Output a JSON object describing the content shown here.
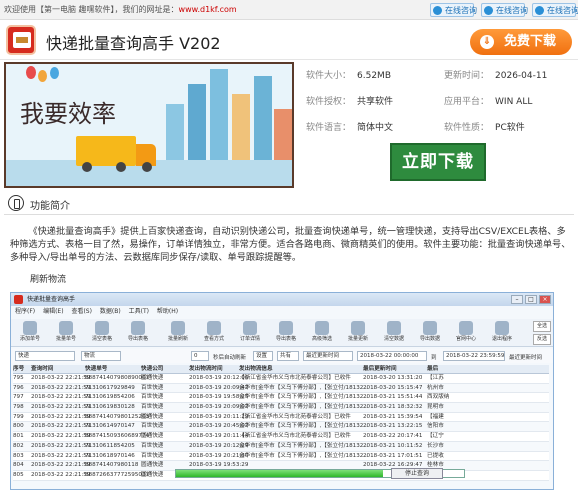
{
  "topbar": {
    "welcome": "欢迎使用【第一电脑 趣嘿软件】，我们的网址是：",
    "url": "www.d1kf.com",
    "consult_buttons": [
      "在线咨询",
      "在线咨询",
      "在线咨询"
    ]
  },
  "header": {
    "title": "快递批量查询高手 V202",
    "download_label": "免费下载"
  },
  "banner": {
    "slogan": "我要效率"
  },
  "info": {
    "size_label": "软件大小：",
    "size": "6.52MB",
    "updated_label": "更新时间：",
    "updated": "2026-04-11",
    "license_label": "软件授权：",
    "license": "共享软件",
    "platform_label": "应用平台：",
    "platform": "WIN ALL",
    "language_label": "软件语言：",
    "language": "简体中文",
    "nature_label": "软件性质：",
    "nature": "PC软件",
    "download_now": "立即下载"
  },
  "section": {
    "title": "功能简介",
    "description": "《快递批量查询高手》提供上百家快递查询，自动识别快递公司，批量查询快递单号，统一管理快递，支持导出CSV/EXCEL表格、多种筛选方式、表格一目了然，易操作，订单详情独立，非常方便。适合各路电商、微商精英们的使用。软件主要功能：批量查询快递单号、多种导入/导出单号的方法、云数据库同步保存/读取、单号跟踪提醒等。",
    "subheading": "刷新物流"
  },
  "app": {
    "window_title": "快递批量查询高手",
    "menu": [
      "程序(F)",
      "编辑(E)",
      "查看(S)",
      "数据(B)",
      "工具(T)",
      "帮助(H)"
    ],
    "toolbar": [
      "添加单号",
      "批量单号",
      "清空表格",
      "导出表格",
      "批量刷新",
      "查看方式",
      "订单详情",
      "导出表格",
      "高级筛选",
      "批量更新",
      "清空数据",
      "导出数据",
      "官网中心",
      "退出程序"
    ],
    "side_buttons": [
      "全选",
      "反选"
    ],
    "filter": {
      "type": "快递",
      "status": "物流",
      "count": "0",
      "auto_refresh": "秒后自动刷新",
      "setting": "设置",
      "all": "共有",
      "recent": "最近更新时间",
      "range_from": "2018-03-22 00:00:00",
      "to": "到",
      "range_to": "2018-03-22 23:59:59",
      "recent_label": "最近更新时间"
    },
    "columns": [
      "序号",
      "查询时间",
      "快递单号",
      "快递公司",
      "发出物流时间",
      "发出物流信息",
      "最后更新时间",
      "最后"
    ],
    "rows": [
      [
        "795",
        "2018-03-22 22:21:59",
        "888741407980890067",
        "圆通快递",
        "2018-03-19 20:12:06",
        "【浙江省金华市义乌市北苑泰睿公司】已收件",
        "2018-03-20 13:31:20",
        "【江苏"
      ],
      [
        "796",
        "2018-03-22 22:21:59",
        "71310617929849",
        "百世快递",
        "2018-03-19 20:09:42",
        "金华市[金华市【义乌下傅分部】,【张立付/18132...",
        "2018-03-20 15:15:47",
        "杭州市"
      ],
      [
        "797",
        "2018-03-22 22:21:59",
        "71310619854206",
        "百世快递",
        "2018-03-19 19:58:25",
        "金华市[金华市【义乌下傅分部】,【张立付/18132...",
        "2018-03-21 15:51:44",
        "西双版纳"
      ],
      [
        "798",
        "2018-03-22 22:21:59",
        "71310619830128",
        "百世快递",
        "2018-03-19 20:09:02",
        "金华市[金华市【义乌下傅分部】,【张立付/18132...",
        "2018-03-21 18:32:32",
        "昆明市"
      ],
      [
        "799",
        "2018-03-22 22:21:59",
        "888741407980125263",
        "圆通快递",
        "2018-03-19 20:11:29",
        "【浙江省金华市义乌市北苑泰睿公司】已收件",
        "2018-03-21 15:39:54",
        "【福建"
      ],
      [
        "800",
        "2018-03-22 22:21:59",
        "71310614970147",
        "百世快递",
        "2018-03-19 20:45:02",
        "金华市[金华市【义乌下傅分部】,【张立付/18132...",
        "2018-03-21 13:22:15",
        "信阳市"
      ],
      [
        "801",
        "2018-03-22 22:21:59",
        "888741509360689774",
        "圆通快递",
        "2018-03-19 20:11:44",
        "【浙江省金华市义乌市北苑泰睿公司】已收件",
        "2018-03-22 20:17:41",
        "【辽宁"
      ],
      [
        "802",
        "2018-03-22 22:21:59",
        "71310611854205",
        "百世快递",
        "2018-03-19 20:12:29",
        "金华市[金华市【义乌下傅分部】,【张立付/18132...",
        "2018-03-21 10:11:52",
        "长沙市"
      ],
      [
        "803",
        "2018-03-22 22:21:59",
        "71310618970146",
        "百世快递",
        "2018-03-19 20:21:30",
        "金华市[金华市【义乌下傅分部】,【张立付/18132...",
        "2018-03-21 17:01:51",
        "已提收"
      ],
      [
        "804",
        "2018-03-22 22:21:59",
        "888741407980118",
        "圆通快递",
        "2018-03-19 19:53:29",
        "",
        "2018-03-22 16:29:47",
        "桂林市"
      ],
      [
        "805",
        "2018-03-22 22:21:59",
        "888726637772595037",
        "圆通快递",
        "2018-03-19 19:47:54",
        "【浙江省金华市义乌市北苑泰睿公司】已收件",
        "2018-03-21 08:38:08",
        "【河北"
      ]
    ],
    "progress": 0.72,
    "stop_label": "停止查询"
  }
}
